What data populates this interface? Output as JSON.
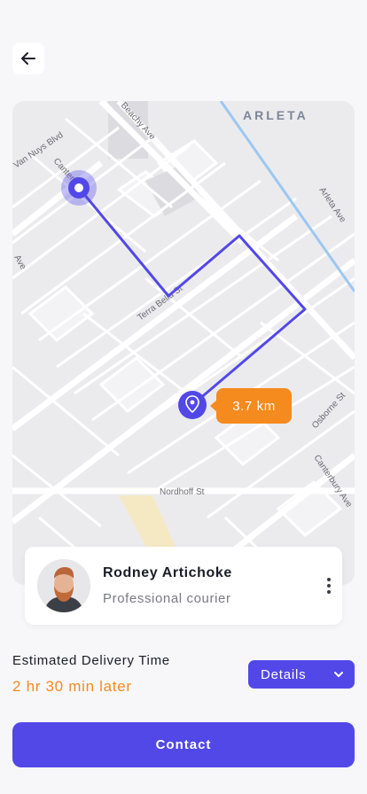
{
  "header": {
    "back_icon": "arrow-left-icon"
  },
  "map": {
    "area_label": "ARLETA",
    "street_labels": {
      "van_nuys": "Van Nuys Blvd",
      "beachy": "Beachy Ave",
      "arleta": "Arleta Ave",
      "canterbury_top": "Canterbury",
      "ave_left": "Ave",
      "terra_bella": "Terra Bella St",
      "osborne": "Osborne St",
      "canterbury": "Canterbury Ave",
      "nordhoff": "Nordhoff St"
    },
    "distance": "3.7 km",
    "route_color": "#5248e8",
    "badge_color": "#f58a1f"
  },
  "courier": {
    "name": "Rodney Artichoke",
    "role": "Professional courier",
    "more_icon": "more-vertical-icon"
  },
  "delivery": {
    "label": "Estimated Delivery Time",
    "value": "2 hr 30 min later"
  },
  "details": {
    "label": "Details",
    "icon": "chevron-down-icon"
  },
  "contact": {
    "label": "Contact"
  },
  "colors": {
    "primary": "#5248e8",
    "accent": "#f58a1f",
    "background": "#f7f7f9"
  }
}
